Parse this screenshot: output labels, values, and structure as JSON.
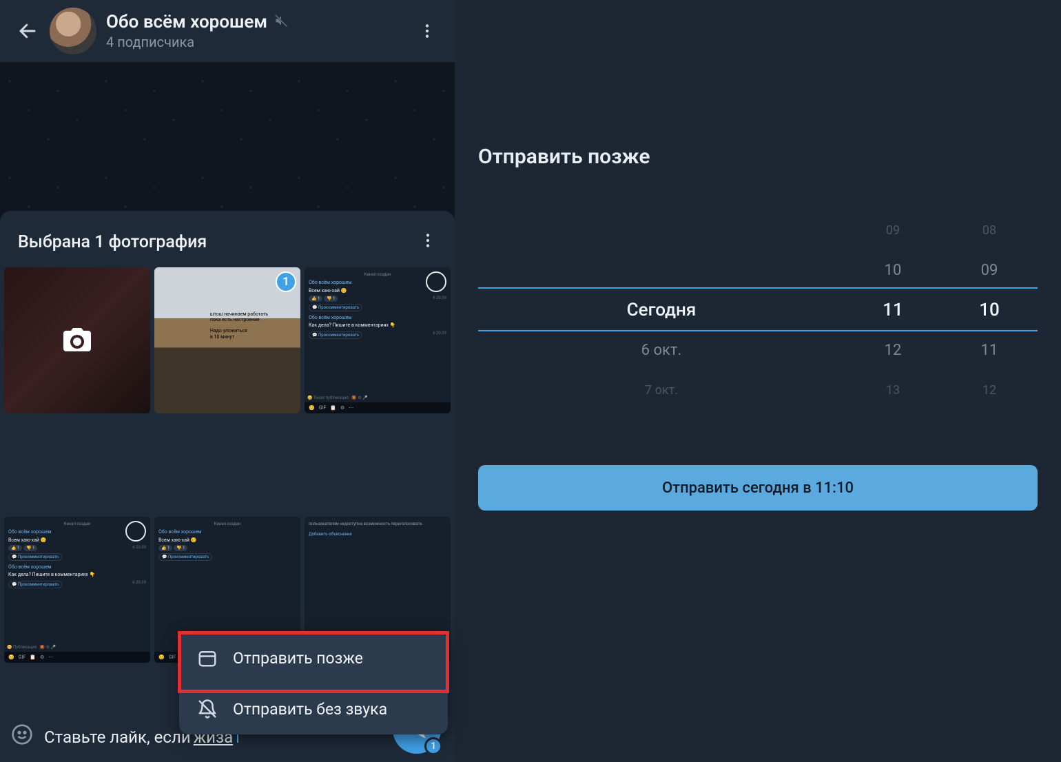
{
  "chat": {
    "title": "Обо всём хорошем",
    "subtitle": "4 подписчика"
  },
  "sheet": {
    "title": "Выбрана 1 фотография",
    "selected_badge": "1"
  },
  "thumbs": {
    "mini_channel_created": "Канал создан",
    "mini_header": "Обо всём хорошем",
    "mini_line1": "Всем хаю-хай 😊",
    "mini_line2": "Как дела? Пишите в комментариях 👇",
    "mini_comment": "Прокомментировать",
    "mini_silent": "Тихая публикация",
    "mini_pub": "Публикация",
    "img2_l1": "штош начинаем работать",
    "img2_l2": "пока есть настроение",
    "img2_l3": "Надо уложиться",
    "img2_l4": "в 10 минут",
    "mini_time1": "6  20:39",
    "mini_time2": "6  20:39",
    "mini_extra": "Добавить объяснение",
    "mini_poll": "пользователям недоступна возможность переголосовать"
  },
  "context_menu": {
    "schedule": "Отправить позже",
    "silent": "Отправить без звука"
  },
  "compose": {
    "text_plain": "Ставьте лайк, если ",
    "text_underlined": "жиза",
    "send_count": "1"
  },
  "schedule": {
    "title": "Отправить позже",
    "rows": [
      {
        "day": "",
        "h": "09",
        "m": "08"
      },
      {
        "day": "",
        "h": "10",
        "m": "09"
      },
      {
        "day": "Сегодня",
        "h": "11",
        "m": "10"
      },
      {
        "day": "6 окт.",
        "h": "12",
        "m": "11"
      },
      {
        "day": "7 окт.",
        "h": "13",
        "m": "12"
      }
    ],
    "confirm": "Отправить сегодня в 11:10"
  }
}
